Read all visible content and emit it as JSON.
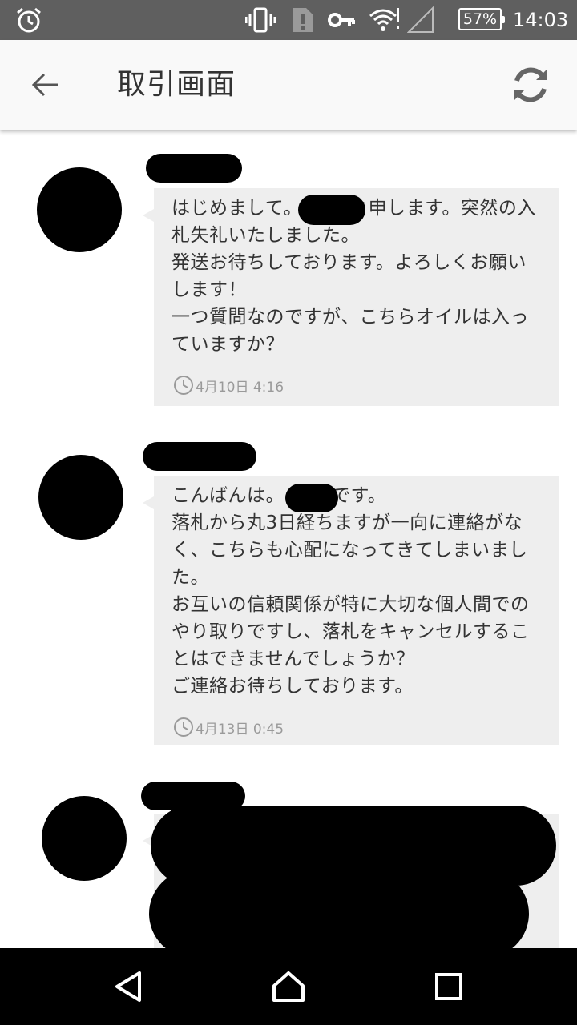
{
  "status_bar": {
    "battery": "57%",
    "time": "14:03",
    "icons": [
      "alarm-icon",
      "vibrate-icon",
      "sim-alert-icon",
      "key-icon",
      "wifi-icon",
      "signal-icon",
      "battery-icon"
    ]
  },
  "app_bar": {
    "title": "取引画面",
    "back_icon": "arrow-back-icon",
    "refresh_icon": "refresh-icon"
  },
  "messages": [
    {
      "text": "はじめまして。　　　と申します。突然の入札失礼いたしました。\n発送お待ちしております。よろしくお願いします！\n一つ質問なのですが、こちらオイルは入っていますか？",
      "timestamp": "4月10日 4:16"
    },
    {
      "text": "こんばんは。　　　です。\n落札から丸3日経ちますが一向に連絡がなく、こちらも心配になってきてしまいました。\nお互いの信頼関係が特に大切な個人間でのやり取りですし、落札をキャンセルすることはできませんでしょうか？\nご連絡お待ちしております。",
      "timestamp": "4月13日 0:45"
    }
  ],
  "nav_bar": {
    "icons": [
      "back-triangle-icon",
      "home-icon",
      "recents-icon"
    ]
  }
}
